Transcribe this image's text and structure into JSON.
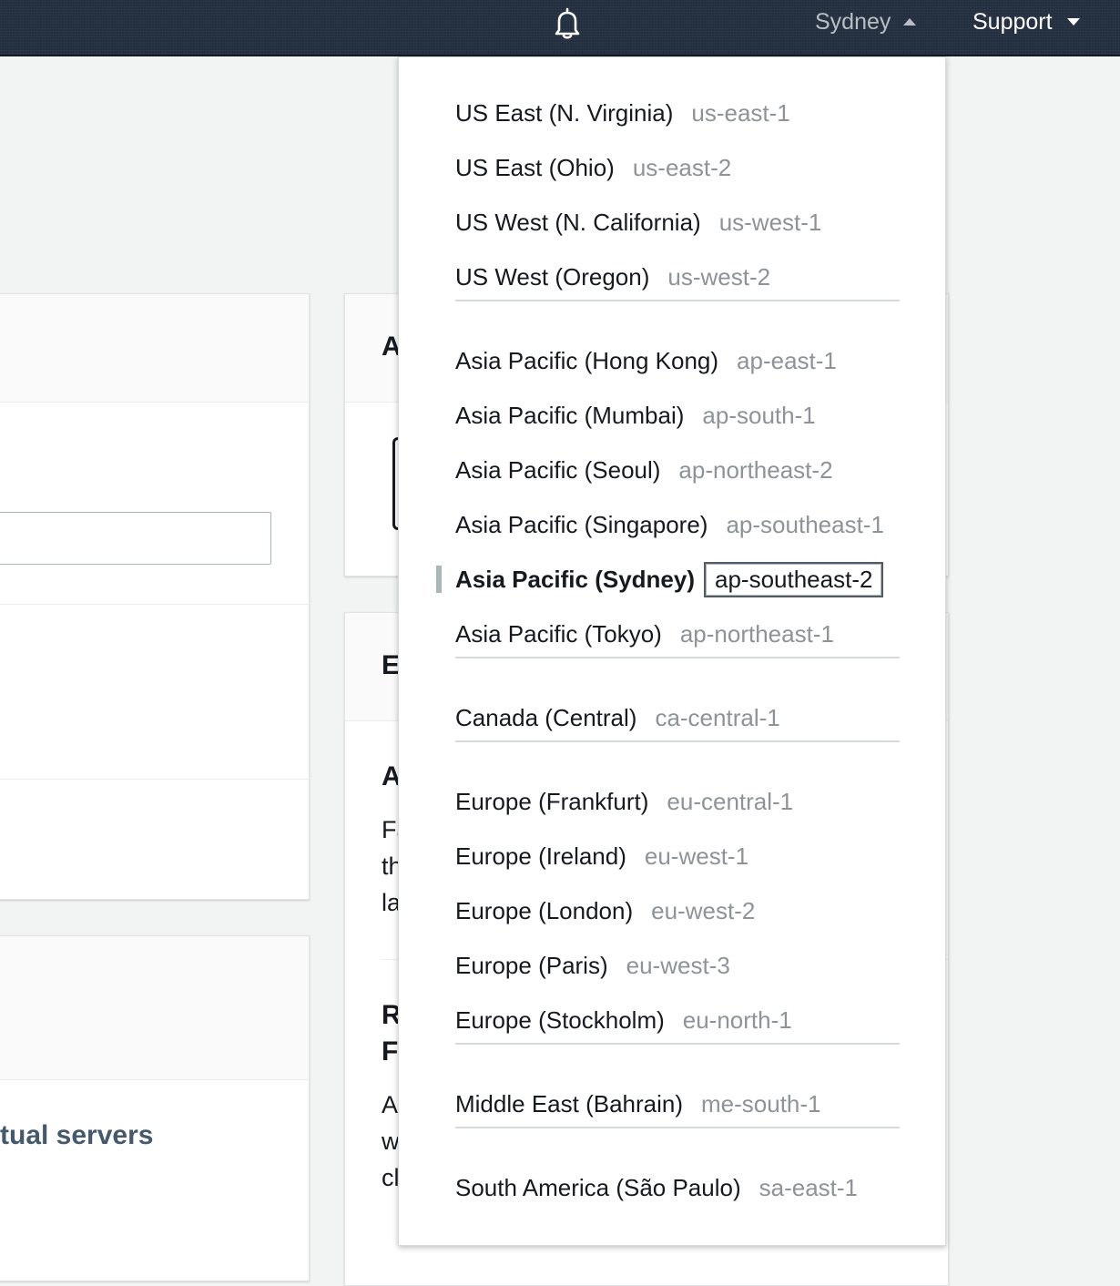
{
  "topnav": {
    "bell_icon": "bell-icon",
    "region_label": "Sydney",
    "support_label": "Support"
  },
  "background": {
    "link_text": "tual servers",
    "peek_letters": [
      "A",
      "E",
      "A",
      "R",
      "F"
    ],
    "peek_text": [
      "Fa",
      "th",
      "la",
      "A",
      "w",
      "cl"
    ]
  },
  "region_menu": {
    "groups": [
      {
        "items": [
          {
            "name": "US East (N. Virginia)",
            "code": "us-east-1"
          },
          {
            "name": "US East (Ohio)",
            "code": "us-east-2"
          },
          {
            "name": "US West (N. California)",
            "code": "us-west-1"
          },
          {
            "name": "US West (Oregon)",
            "code": "us-west-2"
          }
        ]
      },
      {
        "items": [
          {
            "name": "Asia Pacific (Hong Kong)",
            "code": "ap-east-1"
          },
          {
            "name": "Asia Pacific (Mumbai)",
            "code": "ap-south-1"
          },
          {
            "name": "Asia Pacific (Seoul)",
            "code": "ap-northeast-2"
          },
          {
            "name": "Asia Pacific (Singapore)",
            "code": "ap-southeast-1"
          },
          {
            "name": "Asia Pacific (Sydney)",
            "code": "ap-southeast-2",
            "selected": true
          },
          {
            "name": "Asia Pacific (Tokyo)",
            "code": "ap-northeast-1"
          }
        ]
      },
      {
        "items": [
          {
            "name": "Canada (Central)",
            "code": "ca-central-1"
          }
        ]
      },
      {
        "items": [
          {
            "name": "Europe (Frankfurt)",
            "code": "eu-central-1"
          },
          {
            "name": "Europe (Ireland)",
            "code": "eu-west-1"
          },
          {
            "name": "Europe (London)",
            "code": "eu-west-2"
          },
          {
            "name": "Europe (Paris)",
            "code": "eu-west-3"
          },
          {
            "name": "Europe (Stockholm)",
            "code": "eu-north-1"
          }
        ]
      },
      {
        "items": [
          {
            "name": "Middle East (Bahrain)",
            "code": "me-south-1"
          }
        ]
      },
      {
        "items": [
          {
            "name": "South America (São Paulo)",
            "code": "sa-east-1"
          }
        ]
      }
    ]
  }
}
